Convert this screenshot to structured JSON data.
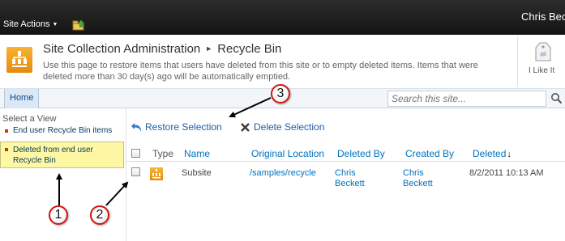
{
  "ribbon": {
    "site_actions_label": "Site Actions",
    "user_name": "Chris Beckett"
  },
  "title_area": {
    "site_title": "Site Collection Administration",
    "page_title": "Recycle Bin",
    "description": "Use this page to restore items that users have deleted from this site or to empty deleted items. Items that were deleted more than 30 day(s) ago will be automatically emptied.",
    "like_label": "I Like It"
  },
  "top_nav": {
    "home_tab": "Home",
    "search_placeholder": "Search this site..."
  },
  "left_nav": {
    "heading": "Select a View",
    "items": [
      {
        "label": "End user Recycle Bin items",
        "selected": false
      },
      {
        "label": "Deleted from end user Recycle Bin",
        "selected": true
      }
    ]
  },
  "toolbar": {
    "restore_label": "Restore Selection",
    "delete_label": "Delete Selection"
  },
  "grid": {
    "columns": [
      "Type",
      "Name",
      "Original Location",
      "Deleted By",
      "Created By",
      "Deleted"
    ],
    "sort_indicator": "↓",
    "rows": [
      {
        "type_icon": "site-icon",
        "name": "Subsite",
        "original_location": "/samples/recycle",
        "deleted_by_first": "Chris",
        "deleted_by_last": "Beckett",
        "created_by_first": "Chris",
        "created_by_last": "Beckett",
        "deleted": "8/2/2011 10:13 AM"
      }
    ]
  },
  "callouts": [
    "1",
    "2",
    "3"
  ],
  "colors": {
    "ribbon": "#1a1a1a",
    "link": "#0072bc",
    "selected_view": "#fef8a4",
    "callout_border": "#d01414"
  }
}
